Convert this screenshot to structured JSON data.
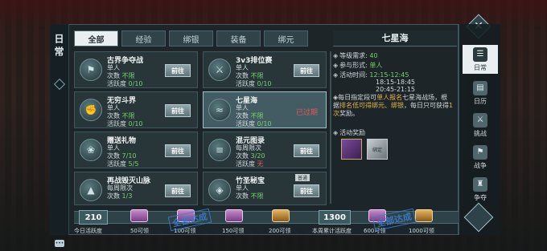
{
  "panel_title": "日常",
  "tabs": [
    "全部",
    "经验",
    "绑银",
    "装备",
    "绑元"
  ],
  "cards": [
    {
      "name": "古界争夺战",
      "l1": "单人",
      "l2_label": "次数",
      "l2_value": "不限",
      "l3_label": "活跃度",
      "l3_value": "0/10",
      "action": "前往",
      "icon": "flag-icon"
    },
    {
      "name": "3v3排位赛",
      "l1": "单人",
      "l2_label": "次数",
      "l2_value": "不限",
      "l3_label": "活跃度",
      "l3_value": "0/10",
      "action": "前往",
      "icon": "sword-icon"
    },
    {
      "name": "无穷斗界",
      "l1": "单人",
      "l2_label": "次数",
      "l2_value": "不限",
      "l3_label": "活跃度",
      "l3_value": "0/10",
      "action": "前往",
      "icon": "fist-icon"
    },
    {
      "name": "七星海",
      "l1": "单人",
      "l2_label": "次数",
      "l2_value": "不限",
      "l3_label": "活跃度",
      "l3_value": "0/10",
      "status": "已过期",
      "icon": "wave-icon"
    },
    {
      "name": "赠送礼物",
      "l1": "单人",
      "l2_label": "次数",
      "l2_value": "7/10",
      "l3_label": "活跃度",
      "l3_value": "5/5",
      "action": "前往",
      "icon": "gift-icon"
    },
    {
      "name": "混元图录",
      "l1": "每周限次",
      "l2_label": "次数",
      "l2_value": "3/20",
      "l3_label": "活跃度",
      "l3_value": "无",
      "action": "前往",
      "icon": "scroll-icon"
    },
    {
      "name": "再战毁灭山脉",
      "l1": "每周限次",
      "l2_label": "次数",
      "l2_value": "1/3",
      "l3_label": "",
      "l3_value": "",
      "action": "前往",
      "icon": "mountain-icon"
    },
    {
      "name": "竹圣秘宝",
      "tag": "普通",
      "l1": "单人",
      "l2_label": "次数",
      "l2_value": "不限",
      "l3_label": "",
      "l3_value": "",
      "action": "前往",
      "icon": "treasure-icon"
    }
  ],
  "detail": {
    "title": "七星海",
    "level_label": "等级需求:",
    "level_value": "40",
    "mode_label": "参与形式:",
    "mode_value": "单人",
    "time_label": "活动时间:",
    "times": [
      "12:15-12:45",
      "18:15-18:45",
      "20:45-21:15"
    ],
    "desc_pre": "每日指定段可",
    "desc_hl1": "单人报名",
    "desc_mid1": "七星海战场，根据",
    "desc_hl2": "排名",
    "desc_mid2": "",
    "desc_hl3": "低可得",
    "desc_mid3": "",
    "desc_hl4": "绑元、绑银",
    "desc_mid4": "，每日只可获得",
    "desc_hl5": "1次",
    "desc_end": "奖励。",
    "reward_label": "活动奖励",
    "reward_badge": "绑定"
  },
  "rail": [
    {
      "label": "日常",
      "icon": "calendar-icon"
    },
    {
      "label": "日历",
      "icon": "book-icon"
    },
    {
      "label": "挑战",
      "icon": "swords-icon"
    },
    {
      "label": "战争",
      "icon": "banner-icon"
    },
    {
      "label": "争夺",
      "icon": "helmet-icon"
    }
  ],
  "bottom": {
    "daily_value": "210",
    "daily_label": "今日活跃度",
    "daily_rewards": [
      "50可领",
      "100可领",
      "150可领",
      "200可领"
    ],
    "weekly_value": "1300",
    "weekly_label": "本周累计活跃度",
    "weekly_rewards": [
      "600可领",
      "1000可领"
    ],
    "stamp1": "全部达成",
    "stamp2": "全部达成"
  },
  "colors": {
    "green": "#74d36a",
    "red": "#e05b4e",
    "gold": "#e6b64e"
  }
}
